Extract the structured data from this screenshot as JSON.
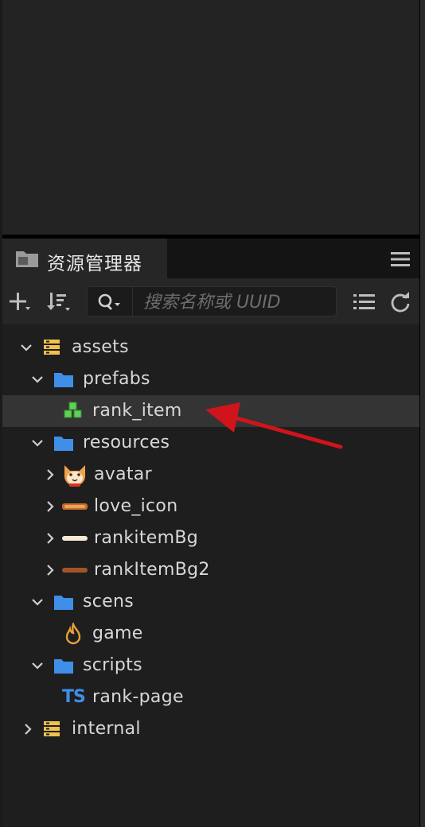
{
  "panel": {
    "title": "资源管理器",
    "search_placeholder": "搜索名称或 UUID"
  },
  "tree": {
    "assets": "assets",
    "prefabs": "prefabs",
    "rank_item": "rank_item",
    "resources": "resources",
    "avatar": "avatar",
    "love_icon": "love_icon",
    "rankitemBg": "rankitemBg",
    "rankItemBg2": "rankItemBg2",
    "scens": "scens",
    "game": "game",
    "scripts": "scripts",
    "rank_page": "rank-page",
    "internal": "internal"
  },
  "icons": {
    "ts_badge": "TS"
  },
  "colors": {
    "folder": "#3f8ee8",
    "db": "#f0c24b",
    "prefab": "#5fcf5a",
    "scene": "#e7a03b",
    "ts": "#3f8ee8",
    "annotation_arrow": "#d0141b"
  }
}
